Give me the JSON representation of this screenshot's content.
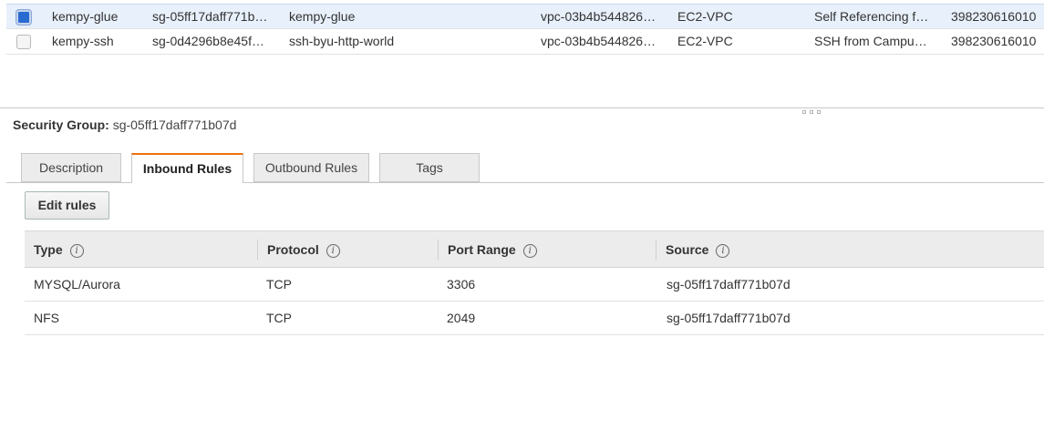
{
  "security_groups": [
    {
      "selected": true,
      "name": "kempy-glue",
      "group_id": "sg-05ff17daff771b…",
      "group_name": "kempy-glue",
      "vpc_id": "vpc-03b4b544826…",
      "type": "EC2-VPC",
      "description": "Self Referencing f…",
      "owner": "398230616010"
    },
    {
      "selected": false,
      "name": "kempy-ssh",
      "group_id": "sg-0d4296b8e45f…",
      "group_name": "ssh-byu-http-world",
      "vpc_id": "vpc-03b4b544826…",
      "type": "EC2-VPC",
      "description": "SSH from Campu…",
      "owner": "398230616010"
    }
  ],
  "detail": {
    "label": "Security Group:",
    "group_id": "sg-05ff17daff771b07d"
  },
  "tabs": [
    {
      "label": "Description",
      "active": false
    },
    {
      "label": "Inbound Rules",
      "active": true
    },
    {
      "label": "Outbound Rules",
      "active": false
    },
    {
      "label": "Tags",
      "active": false
    }
  ],
  "edit_rules_label": "Edit rules",
  "info_glyph": "i",
  "rules": {
    "columns": [
      "Type",
      "Protocol",
      "Port Range",
      "Source"
    ],
    "rows": [
      [
        "MYSQL/Aurora",
        "TCP",
        "3306",
        "sg-05ff17daff771b07d"
      ],
      [
        "NFS",
        "TCP",
        "2049",
        "sg-05ff17daff771b07d"
      ]
    ]
  },
  "colors": {
    "accent_tab": "#ec7211",
    "selected_row": "#e8f0fb",
    "checkbox_checked": "#2a6bd1"
  }
}
